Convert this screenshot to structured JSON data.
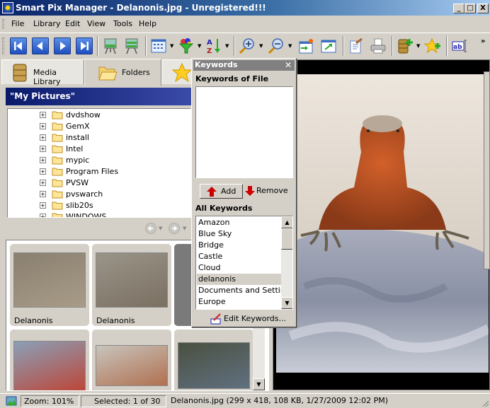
{
  "window": {
    "title": "Smart Pix Manager - Delanonis.jpg - Unregistered!!!",
    "controls": {
      "minimize": "_",
      "maximize": "□",
      "close": "X"
    }
  },
  "menubar": {
    "items": [
      {
        "label": "File"
      },
      {
        "label": "Library"
      },
      {
        "label": "Edit"
      },
      {
        "label": "View"
      },
      {
        "label": "Tools"
      },
      {
        "label": "Help"
      }
    ]
  },
  "toolbar": {
    "buttons": [
      {
        "icon": "first-icon",
        "tooltip": "First"
      },
      {
        "icon": "previous-icon",
        "tooltip": "Previous"
      },
      {
        "icon": "next-icon",
        "tooltip": "Next"
      },
      {
        "icon": "last-icon",
        "tooltip": "Last"
      },
      {
        "icon": "slideshow-icon"
      },
      {
        "icon": "slideshow-multi-icon"
      },
      {
        "icon": "view-mode-icon",
        "dropdown": true
      },
      {
        "icon": "filter-icon",
        "dropdown": true
      },
      {
        "icon": "sort-az-icon",
        "dropdown": true
      },
      {
        "icon": "zoom-in-icon",
        "dropdown": true
      },
      {
        "icon": "zoom-out-icon",
        "dropdown": true
      },
      {
        "icon": "import-icon"
      },
      {
        "icon": "open-external-icon"
      },
      {
        "icon": "edit-properties-icon"
      },
      {
        "icon": "print-icon"
      },
      {
        "icon": "add-to-library-icon",
        "dropdown": true
      },
      {
        "icon": "add-favorite-icon"
      },
      {
        "icon": "rename-icon"
      }
    ],
    "overflow": "»"
  },
  "tabs": [
    {
      "label": "Media Library",
      "icon": "library-barrel-icon",
      "active": false
    },
    {
      "label": "Folders",
      "icon": "folder-open-icon",
      "active": true
    },
    {
      "label": "",
      "icon": "favorites-star-icon",
      "active": false
    }
  ],
  "left_pane": {
    "path_header": "\"My Pictures\"",
    "tree": [
      {
        "name": "dvdshow"
      },
      {
        "name": "GemX"
      },
      {
        "name": "install"
      },
      {
        "name": "Intel"
      },
      {
        "name": "mypic"
      },
      {
        "name": "Program Files"
      },
      {
        "name": "PVSW"
      },
      {
        "name": "pvswarch"
      },
      {
        "name": "slib20s"
      },
      {
        "name": "WINDOWS"
      }
    ],
    "thumbnails": [
      {
        "caption": "Delanonis",
        "selected": false,
        "colors": [
          "#8a8070",
          "#a89c88"
        ]
      },
      {
        "caption": "Delanonis",
        "selected": false,
        "colors": [
          "#9a9488",
          "#7a7062"
        ]
      },
      {
        "caption": "",
        "selected": true,
        "colors": [
          "#7a7a7a",
          "#7a7a7a"
        ]
      },
      {
        "caption": "",
        "selected": false,
        "colors": [
          "#8aa0b8",
          "#c04030"
        ]
      },
      {
        "caption": "",
        "selected": false,
        "colors": [
          "#c8c4bc",
          "#b07050"
        ]
      },
      {
        "caption": "",
        "selected": false,
        "colors": [
          "#4a5040",
          "#607080"
        ]
      }
    ]
  },
  "keywords_panel": {
    "title": "Keywords",
    "close": "✕",
    "file_keywords_label": "Keywords of File",
    "file_keywords": [],
    "add_label": "Add",
    "remove_label": "Remove",
    "all_keywords_label": "All Keywords",
    "all_keywords": [
      {
        "label": "Amazon"
      },
      {
        "label": "Blue Sky"
      },
      {
        "label": "Bridge"
      },
      {
        "label": "Castle"
      },
      {
        "label": "Cloud"
      },
      {
        "label": "delanonis",
        "selected": true
      },
      {
        "label": "Documents and Settings"
      },
      {
        "label": "Europe"
      }
    ],
    "edit_label": "Edit Keywords..."
  },
  "statusbar": {
    "zoom": "Zoom: 101%",
    "selected": "Selected: 1 of 30",
    "file_info": "Delanonis.jpg  (299 x 418, 108 KB, 1/27/2009 12:02 PM)"
  },
  "colors": {
    "title_start": "#0a246a",
    "title_end": "#a6caf0",
    "panel_bg": "#d4d0c8",
    "path_header": "#0a1a6a"
  }
}
